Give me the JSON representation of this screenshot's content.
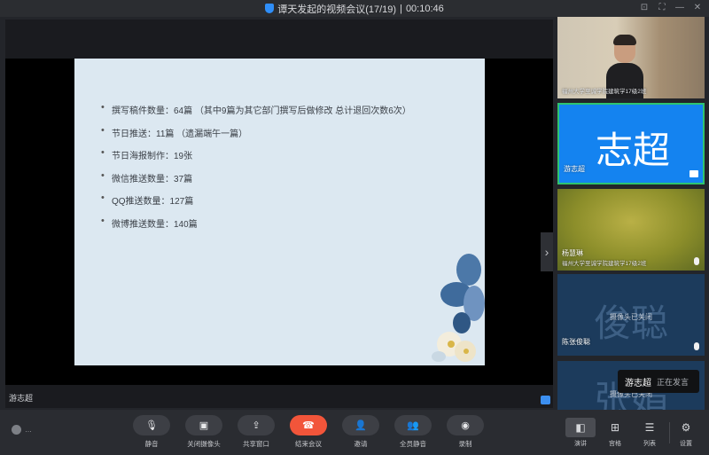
{
  "window": {
    "title": "谭天发起的视频会议(17/19)",
    "separator": "|",
    "timer": "00:10:46",
    "controls": [
      "⊡",
      "⛶",
      "—",
      "✕"
    ]
  },
  "slide": {
    "bullets": [
      "撰写稿件数量：64篇 （其中9篇为其它部门撰写后做修改  总计退回次数6次）",
      "节日推送：11篇 （遗漏端午一篇）",
      "节日海报制作：19张",
      "微信推送数量：37篇",
      "QQ推送数量：127篇",
      "微博推送数量：140篇"
    ],
    "next_arrow": "›"
  },
  "stage": {
    "speaker_name": "游志超"
  },
  "tiles": [
    {
      "name": "",
      "subtitle": "福州大学至诚学院建筑学17级2班",
      "kind": "camera"
    },
    {
      "name": "游志超",
      "avatar_text": "志超",
      "kind": "avatar",
      "color": "#1483f0"
    },
    {
      "name": "杨慧琳",
      "subtitle": "福州大学至诚学院建筑学17级2班",
      "kind": "camera"
    },
    {
      "name": "陈张俊聪",
      "avatar_text": "俊聪",
      "overlay": "摄像头已关闭",
      "kind": "avatar"
    },
    {
      "name": "",
      "avatar_text": "张娟",
      "overlay": "摄像头已关闭",
      "kind": "avatar"
    }
  ],
  "toast": {
    "name": "游志超",
    "status": "正在发言"
  },
  "toolbar": {
    "left_label": "…",
    "buttons": [
      {
        "label": "静音",
        "icon": "mic-icon",
        "glyph": "🎙"
      },
      {
        "label": "关闭摄像头",
        "icon": "camera-icon",
        "glyph": "▣"
      },
      {
        "label": "共享窗口",
        "icon": "share-icon",
        "glyph": "⇪"
      },
      {
        "label": "结束会议",
        "icon": "hangup-icon",
        "glyph": "☎"
      },
      {
        "label": "邀请",
        "icon": "invite-icon",
        "glyph": "👤"
      },
      {
        "label": "全员静音",
        "icon": "mute-all-icon",
        "glyph": "👥"
      },
      {
        "label": "录制",
        "icon": "record-icon",
        "glyph": "◉"
      }
    ],
    "right_buttons": [
      {
        "label": "演讲",
        "icon": "speaker-view-icon",
        "glyph": "◧",
        "active": true
      },
      {
        "label": "宫格",
        "icon": "grid-view-icon",
        "glyph": "⊞",
        "active": false
      },
      {
        "label": "列表",
        "icon": "list-view-icon",
        "glyph": "☰",
        "active": false
      },
      {
        "label": "设置",
        "icon": "gear-icon",
        "glyph": "⚙",
        "active": false
      }
    ]
  }
}
